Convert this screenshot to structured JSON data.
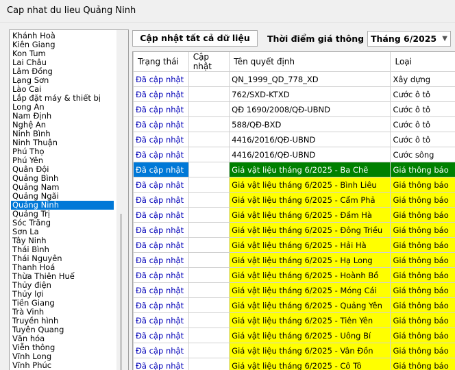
{
  "window": {
    "title": "Cap nhat du lieu Quảng Ninh"
  },
  "provinces": {
    "items": [
      "Khánh Hoà",
      "Kiên Giang",
      "Kon Tum",
      "Lai Châu",
      "Lâm Đồng",
      "Lạng Sơn",
      "Lào Cai",
      "Lắp đặt máy & thiết bị",
      "Long An",
      "Nam Định",
      "Nghệ An",
      "Ninh Bình",
      "Ninh Thuận",
      "Phú Thọ",
      "Phú Yên",
      "Quân Đội",
      "Quảng Bình",
      "Quảng Nam",
      "Quảng Ngãi",
      "Quảng Ninh",
      "Quảng Trị",
      "Sóc Trăng",
      "Sơn La",
      "Tây Ninh",
      "Thái Bình",
      "Thái Nguyên",
      "Thanh Hoá",
      "Thừa Thiên Huế",
      "Thủy điện",
      "Thủy lợi",
      "Tiền Giang",
      "Trà Vinh",
      "Truyền hình",
      "Tuyên Quang",
      "Văn hóa",
      "Viễn thông",
      "Vĩnh Long",
      "Vĩnh Phúc"
    ],
    "selected": "Quảng Ninh"
  },
  "toolbar": {
    "update_all_label": "Cập nhật tất cả dữ liệu",
    "time_label": "Thời điểm giá thông báo",
    "period_value": "Tháng 6/2025"
  },
  "grid": {
    "headers": [
      "Trạng thái",
      "Cập nhật",
      "Tên quyết định",
      "Loại"
    ],
    "rows": [
      {
        "status": "Đã cập nhật",
        "update": "",
        "name": "QN_1999_QD_778_XD",
        "type": "Xây dựng",
        "color": "none"
      },
      {
        "status": "Đã cập nhật",
        "update": "",
        "name": "762/SXD-KTXD",
        "type": "Cước ô tô",
        "color": "none"
      },
      {
        "status": "Đã cập nhật",
        "update": "",
        "name": "QĐ 1690/2008/QĐ-UBND",
        "type": "Cước ô tô",
        "color": "none"
      },
      {
        "status": "Đã cập nhật",
        "update": "",
        "name": "588/QĐ-BXD",
        "type": "Cước ô tô",
        "color": "none"
      },
      {
        "status": "Đã cập nhật",
        "update": "",
        "name": "4416/2016/QĐ-UBND",
        "type": "Cước ô tô",
        "color": "none"
      },
      {
        "status": "Đã cập nhật",
        "update": "",
        "name": "4416/2016/QĐ-UBND",
        "type": "Cước sông",
        "color": "none"
      },
      {
        "status": "Đã cập nhật",
        "update": "",
        "name": "Giá vật liệu tháng 6/2025 - Ba Chẽ",
        "type": "Giá thông báo",
        "color": "green",
        "selected": true
      },
      {
        "status": "Đã cập nhật",
        "update": "",
        "name": "Giá vật liệu tháng 6/2025 - Bình Liêu",
        "type": "Giá thông báo",
        "color": "yellow"
      },
      {
        "status": "Đã cập nhật",
        "update": "",
        "name": "Giá vật liệu tháng 6/2025 - Cẩm Phả",
        "type": "Giá thông báo",
        "color": "yellow"
      },
      {
        "status": "Đã cập nhật",
        "update": "",
        "name": "Giá vật liệu tháng 6/2025 - Đầm Hà",
        "type": "Giá thông báo",
        "color": "yellow"
      },
      {
        "status": "Đã cập nhật",
        "update": "",
        "name": "Giá vật liệu tháng 6/2025 - Đông Triều",
        "type": "Giá thông báo",
        "color": "yellow"
      },
      {
        "status": "Đã cập nhật",
        "update": "",
        "name": "Giá vật liệu tháng 6/2025 - Hải Hà",
        "type": "Giá thông báo",
        "color": "yellow"
      },
      {
        "status": "Đã cập nhật",
        "update": "",
        "name": "Giá vật liệu tháng 6/2025 - Hạ Long",
        "type": "Giá thông báo",
        "color": "yellow"
      },
      {
        "status": "Đã cập nhật",
        "update": "",
        "name": "Giá vật liệu tháng 6/2025 - Hoành Bồ",
        "type": "Giá thông báo",
        "color": "yellow"
      },
      {
        "status": "Đã cập nhật",
        "update": "",
        "name": "Giá vật liệu tháng 6/2025 - Móng Cái",
        "type": "Giá thông báo",
        "color": "yellow"
      },
      {
        "status": "Đã cập nhật",
        "update": "",
        "name": "Giá vật liệu tháng 6/2025 - Quảng Yên",
        "type": "Giá thông báo",
        "color": "yellow"
      },
      {
        "status": "Đã cập nhật",
        "update": "",
        "name": "Giá vật liệu tháng 6/2025 - Tiên Yên",
        "type": "Giá thông báo",
        "color": "yellow"
      },
      {
        "status": "Đã cập nhật",
        "update": "",
        "name": "Giá vật liệu tháng 6/2025 - Uông Bí",
        "type": "Giá thông báo",
        "color": "yellow"
      },
      {
        "status": "Đã cập nhật",
        "update": "",
        "name": "Giá vật liệu tháng 6/2025 - Vân Đồn",
        "type": "Giá thông báo",
        "color": "yellow"
      },
      {
        "status": "Đã cập nhật",
        "update": "",
        "name": "Giá vật liệu tháng 6/2025 - Cô Tô",
        "type": "Giá thông báo",
        "color": "yellow"
      }
    ]
  }
}
